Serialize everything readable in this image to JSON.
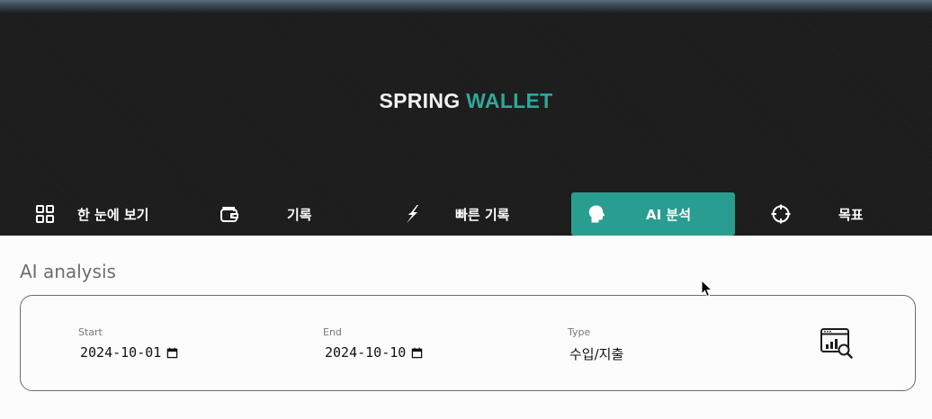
{
  "app": {
    "brand_part1": "SPRING",
    "brand_part2": "WALLET"
  },
  "colors": {
    "accent": "#2a9d91",
    "header_bg": "#1c1c1c",
    "brand_highlight": "#2fa79a"
  },
  "nav": {
    "items": [
      {
        "label": "한 눈에 보기",
        "icon": "grid-icon",
        "active": false
      },
      {
        "label": "기록",
        "icon": "wallet-icon",
        "active": false
      },
      {
        "label": "빠른 기록",
        "icon": "lightning-icon",
        "active": false
      },
      {
        "label": "AI 분석",
        "icon": "ai-head-icon",
        "active": true
      },
      {
        "label": "목표",
        "icon": "target-icon",
        "active": false
      }
    ]
  },
  "main": {
    "title": "AI analysis",
    "filters": {
      "start_label": "Start",
      "start_value": "2024-10-01",
      "end_label": "End",
      "end_value": "2024-10-10",
      "type_label": "Type",
      "type_value": "수입/지출"
    },
    "search_icon": "chart-search-icon"
  }
}
